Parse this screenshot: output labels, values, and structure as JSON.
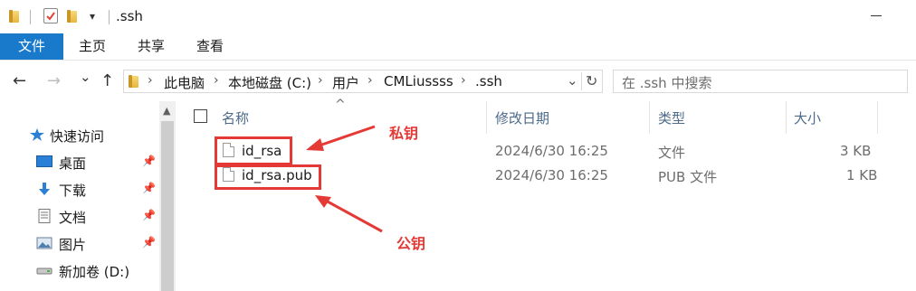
{
  "window": {
    "title": ".ssh"
  },
  "qat": {
    "dropdown_glyph": "▾"
  },
  "ribbon": {
    "tabs": [
      "文件",
      "主页",
      "共享",
      "查看"
    ]
  },
  "nav_buttons": {
    "back": "←",
    "forward": "→",
    "recent": "⌄",
    "up": "↑"
  },
  "address": {
    "crumbs": [
      "此电脑",
      "本地磁盘 (C:)",
      "用户",
      "CMLiussss",
      ".ssh"
    ],
    "separator": "›",
    "dropdown": "⌄",
    "refresh": "↻"
  },
  "search": {
    "placeholder": "在 .ssh 中搜索"
  },
  "sidebar": {
    "items": [
      {
        "label": "快速访问",
        "icon": "star-icon",
        "pinned": false
      },
      {
        "label": "桌面",
        "icon": "desktop-icon",
        "pinned": true
      },
      {
        "label": "下载",
        "icon": "download-icon",
        "pinned": true
      },
      {
        "label": "文档",
        "icon": "document-icon",
        "pinned": true
      },
      {
        "label": "图片",
        "icon": "picture-icon",
        "pinned": true
      },
      {
        "label": "新加卷 (D:)",
        "icon": "drive-icon",
        "pinned": false
      }
    ],
    "pin_glyph": "📌"
  },
  "columns": {
    "name": "名称",
    "modified": "修改日期",
    "type": "类型",
    "size": "大小",
    "sort_glyph": "^"
  },
  "files": [
    {
      "name": "id_rsa",
      "modified": "2024/6/30 16:25",
      "type": "文件",
      "size": "3 KB"
    },
    {
      "name": "id_rsa.pub",
      "modified": "2024/6/30 16:25",
      "type": "PUB 文件",
      "size": "1 KB"
    }
  ],
  "annotations": {
    "private_key": "私钥",
    "public_key": "公钥"
  },
  "colors": {
    "accent": "#1979ca",
    "annotation": "#e53935"
  }
}
